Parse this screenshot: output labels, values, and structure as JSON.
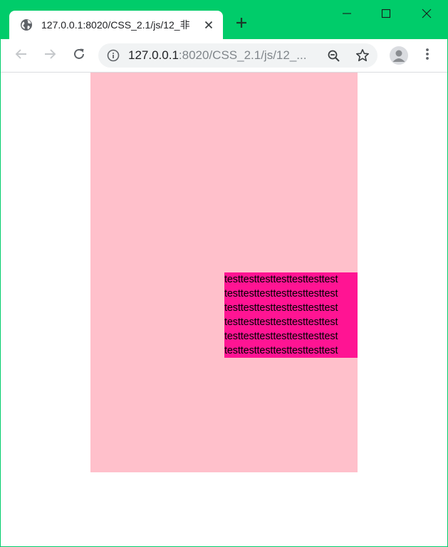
{
  "browser": {
    "tab": {
      "title": "127.0.0.1:8020/CSS_2.1/js/12_非",
      "favicon": "globe-icon",
      "close": "close-icon"
    },
    "new_tab": "plus-icon",
    "window_controls": [
      "minimize-icon",
      "maximize-icon",
      "close-icon"
    ],
    "toolbar": {
      "back": "arrow-left-icon",
      "forward": "arrow-right-icon",
      "reload": "reload-icon",
      "address": {
        "host": "127.0.0.1",
        "path": ":8020/CSS_2.1/js/12_...",
        "info_icon": "info-icon",
        "zoom_icon": "zoom-out-icon",
        "star_icon": "star-icon"
      },
      "profile": "avatar-icon",
      "menu": "more-vertical-icon"
    },
    "colors": {
      "titlebar": "#00cc6a",
      "outer_box": "#ffc0cb",
      "inner_box": "#ff1493"
    }
  },
  "page": {
    "inner_box": {
      "lines": [
        "testtesttesttesttesttesttest",
        "testtesttesttesttesttesttest",
        "testtesttesttesttesttesttest",
        "testtesttesttesttesttesttest",
        "testtesttesttesttesttesttest",
        "testtesttesttesttesttesttest"
      ]
    }
  }
}
